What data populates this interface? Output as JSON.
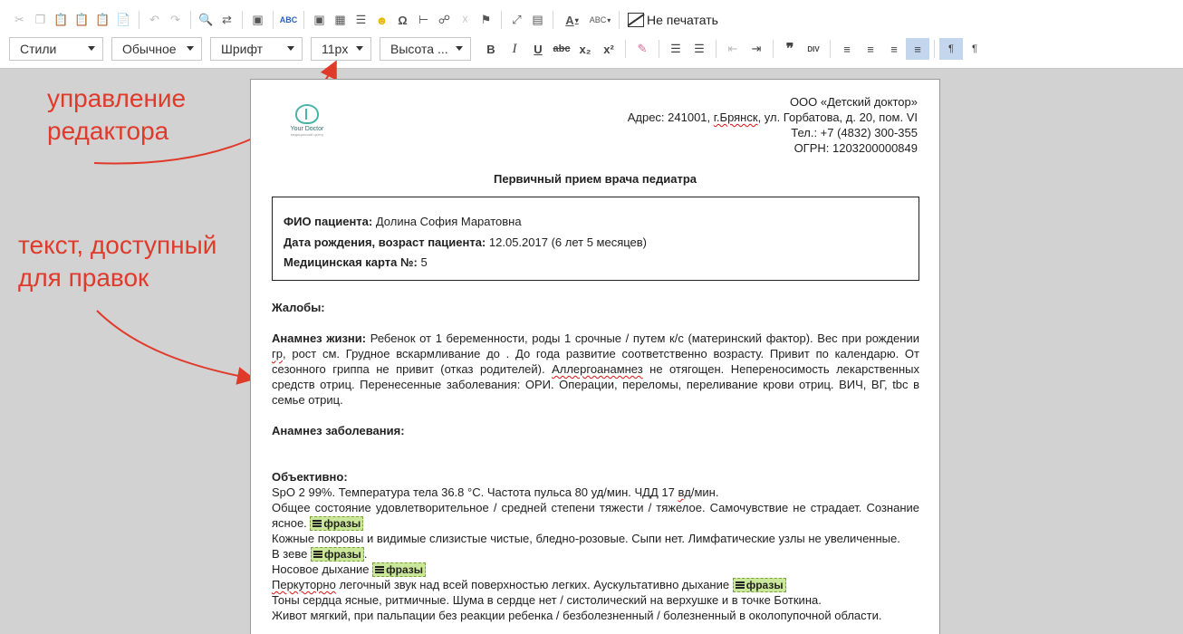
{
  "toolbar": {
    "no_print_label": "Не печатать",
    "combos": {
      "styles": "Стили",
      "format": "Обычное",
      "font": "Шрифт",
      "size": "11px",
      "line_height": "Высота ..."
    },
    "glyphs": {
      "spell": "ABC",
      "omega": "Ω",
      "bold": "B",
      "italic": "I",
      "underline": "U",
      "strike": "abc",
      "sub": "x₂",
      "sup": "x²",
      "quote": "❞",
      "div": "DIV",
      "text_color": "A",
      "para": "¶"
    }
  },
  "annotations": {
    "editor_controls": [
      "управление",
      "редактора"
    ],
    "editable_text": [
      "текст, доступный",
      "для правок"
    ]
  },
  "document": {
    "logo": {
      "name": "Your Doctor",
      "tagline": "медицинский центр"
    },
    "org": {
      "name": "ООО «Детский доктор»",
      "address_prefix": "Адрес: 241001, ",
      "address_city": "г.Брянск",
      "address_suffix": ", ул. Горбатова, д. 20, пом. VI",
      "phone": "Тел.: +7 (4832) 300-355",
      "ogrn": "ОГРН: 1203200000849"
    },
    "title": "Первичный прием врача педиатра",
    "patient": {
      "name_label": "ФИО пациента:",
      "name_value": " Долина София Маратовна",
      "dob_label": "Дата рождения, возраст пациента:",
      "dob_value": " 12.05.2017 (6 лет 5 месяцев)",
      "card_label": "Медицинская карта №:",
      "card_value": " 5"
    },
    "complaints_label": "Жалобы:",
    "anamnesis_life_label": "Анамнез жизни:",
    "anamnesis_life_1": " Ребенок от 1 беременности, роды 1 срочные / путем к/с (материнский фактор). Вес при рождении ",
    "anamnesis_life_gr": "гр",
    "anamnesis_life_2": ", рост  см. Грудное вскармливание до   . До года развитие соответственно возрасту.  Привит по календарю. От сезонного гриппа не привит (отказ родителей). ",
    "anamnesis_life_allergo": "Аллергоанамнез",
    "anamnesis_life_3": " не отягощен. Непереносимость лекарственных средств отриц. Перенесенные заболевания: ОРИ. Операции, переломы, переливание крови отриц. ВИЧ, ВГ, tbc в семье отриц.",
    "anamnesis_disease_label": "Анамнез заболевания:",
    "objective_label": "Объективно:",
    "objective_1a": "SpO 2 99%. Температура тела 36.8 °С. Частота пульса 80 уд/мин. ЧДД 17 ",
    "objective_1b": "вд",
    "objective_1c": "/мин.",
    "objective_2": "Общее состояние удовлетворительное / средней степени тяжести / тяжелое. Самочувствие не страдает. Сознание ясное. ",
    "objective_3": "Кожные покровы и видимые слизистые чистые, бледно-розовые. Сыпи нет. Лимфатические узлы не увеличенные.",
    "objective_4": "В зеве ",
    "objective_5": "Носовое дыхание ",
    "objective_6a": "Перкуторно",
    "objective_6b": " легочный звук над всей поверхностью легких. Аускультативно дыхание ",
    "objective_7": "Тоны сердца ясные, ритмичные. Шума в сердце нет / систолический на верхушке и в точке Боткина.",
    "objective_8": "Живот мягкий, при пальпации без реакции ребенка / безболезненный / болезненный в околопупочной области.",
    "phrase_chip": "фразы"
  }
}
